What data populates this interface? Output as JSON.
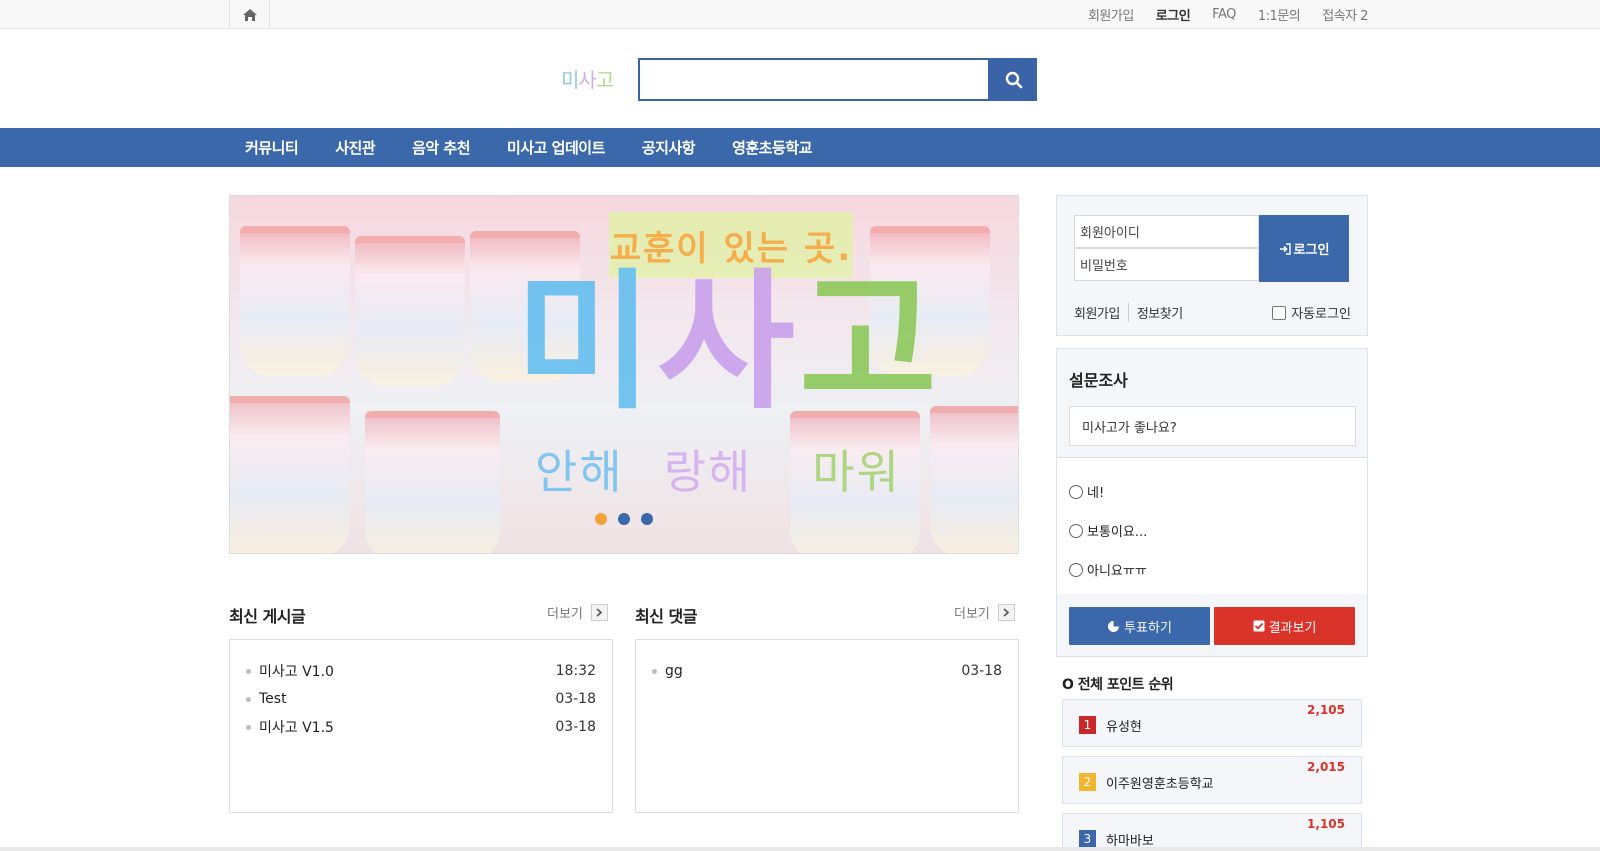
{
  "topbar": {
    "links": [
      "회원가입",
      "로그인",
      "FAQ",
      "1:1문의",
      "접속자 2"
    ]
  },
  "header": {
    "logo": {
      "part1": "미",
      "part2": "사",
      "part3": "고"
    },
    "search_placeholder": ""
  },
  "nav": {
    "items": [
      "커뮤니티",
      "사진관",
      "음악 추천",
      "미사고 업데이트",
      "공지사항",
      "영훈초등학교"
    ]
  },
  "slider": {
    "tag": "교훈이 있는 곳.",
    "big": {
      "c1": "미",
      "c2": "사",
      "c3": "고"
    },
    "sub": {
      "s1": "안해",
      "s2": "랑해",
      "s3": "마워"
    },
    "active_dot": 0,
    "dot_count": 3
  },
  "latest_posts": {
    "title": "최신 게시글",
    "more": "더보기",
    "rows": [
      {
        "title": "미사고 V1.0",
        "date": "18:32"
      },
      {
        "title": "Test",
        "date": "03-18"
      },
      {
        "title": "미사고 V1.5",
        "date": "03-18"
      }
    ]
  },
  "latest_comments": {
    "title": "최신 댓글",
    "more": "더보기",
    "rows": [
      {
        "title": "gg",
        "date": "03-18"
      }
    ]
  },
  "login": {
    "id_placeholder": "회원아이디",
    "pw_placeholder": "비밀번호",
    "button": "로그인",
    "signup": "회원가입",
    "find": "정보찾기",
    "auto_login": "자동로그인"
  },
  "poll": {
    "title": "설문조사",
    "question": "미사고가 좋나요?",
    "options": [
      "네!",
      "보통이요...",
      "아니요ㅠㅠ"
    ],
    "vote_button": "투표하기",
    "result_button": "결과보기"
  },
  "ranking": {
    "title": "O 전체 포인트 순위",
    "items": [
      {
        "rank": "1",
        "name": "유성현",
        "points": "2,105",
        "color": "#c8292a"
      },
      {
        "rank": "2",
        "name": "이주원영훈초등학교",
        "points": "2,015",
        "color": "#f1b52e"
      },
      {
        "rank": "3",
        "name": "하마바보",
        "points": "1,105",
        "color": "#3b67ab"
      }
    ]
  },
  "colors": {
    "primary": "#3b67ab",
    "danger": "#d9332a",
    "dot_active": "#f5a23a"
  }
}
